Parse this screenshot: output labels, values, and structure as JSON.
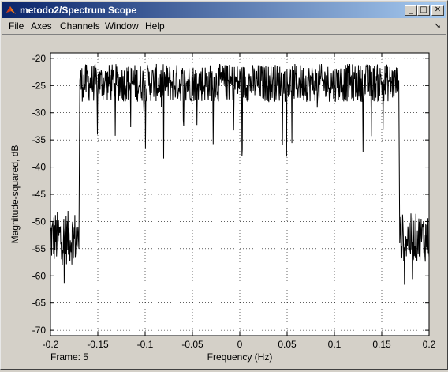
{
  "window": {
    "title": "metodo2/Spectrum Scope",
    "controls": {
      "minimize": "_",
      "maximize": "□",
      "close": "✕"
    }
  },
  "menu": {
    "items": [
      "File",
      "Axes",
      "Channels",
      "Window",
      "Help"
    ],
    "dock_arrow": "↘"
  },
  "status": {
    "frame_label": "Frame:  5"
  },
  "chart_data": {
    "type": "line",
    "xlabel": "Frequency (Hz)",
    "ylabel": "Magnitude-squared, dB",
    "xlim": [
      -0.2,
      0.2
    ],
    "ylim": [
      -71,
      -19
    ],
    "xticks": [
      -0.2,
      -0.15,
      -0.1,
      -0.05,
      0,
      0.05,
      0.1,
      0.15,
      0.2
    ],
    "xtick_labels": [
      "-0.2",
      "-0.15",
      "-0.1",
      "-0.05",
      "0",
      "0.05",
      "0.1",
      "0.15",
      "0.2"
    ],
    "yticks": [
      -20,
      -25,
      -30,
      -35,
      -40,
      -45,
      -50,
      -55,
      -60,
      -65,
      -70
    ],
    "ytick_labels": [
      "-20",
      "-25",
      "-30",
      "-35",
      "-40",
      "-45",
      "-50",
      "-55",
      "-60",
      "-65",
      "-70"
    ],
    "grid": true,
    "line_color": "#000000",
    "series": [
      {
        "segments": [
          {
            "x_range": [
              -0.2,
              -0.171
            ],
            "mean": -53,
            "spread": 5,
            "spike_min": -68
          },
          {
            "x_range": [
              -0.168,
              0.167
            ],
            "mean": -24.5,
            "spread": 3.5,
            "spike_min": -39,
            "clip_max": -19
          },
          {
            "x_range": [
              0.17,
              0.2
            ],
            "mean": -53,
            "spread": 4.5,
            "spike_min": -65
          }
        ],
        "transitions": [
          {
            "x": -0.17,
            "from": -55,
            "to": -24
          },
          {
            "x": 0.168,
            "from": -24,
            "to": -54
          }
        ]
      }
    ]
  }
}
